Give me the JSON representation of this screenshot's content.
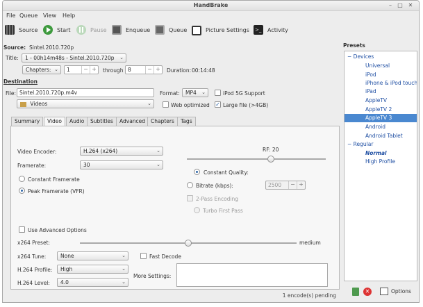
{
  "window": {
    "title": "HandBrake",
    "controls": [
      "–",
      "□",
      "✕"
    ]
  },
  "menu": [
    "File",
    "Queue",
    "View",
    "Help"
  ],
  "toolbar": {
    "source": "Source",
    "start": "Start",
    "pause": "Pause",
    "enqueue": "Enqueue",
    "queue": "Queue",
    "picture_settings": "Picture Settings",
    "activity": "Activity"
  },
  "source": {
    "label": "Source:",
    "value": "Sintel.2010.720p",
    "title_label": "Title:",
    "title_value": "1 - 00h14m48s - Sintel.2010.720p",
    "range_type": "Chapters:",
    "range_start": "1",
    "through_label": "through",
    "range_end": "8",
    "duration_label": "Duration:",
    "duration_value": "00:14:48"
  },
  "destination": {
    "label": "Destination",
    "file_label": "File:",
    "file_value": "Sintel.2010.720p.m4v",
    "format_label": "Format:",
    "format_value": "MP4",
    "ipod_label": "iPod 5G Support",
    "ipod_checked": false,
    "folder": "Videos",
    "web_label": "Web optimized",
    "web_checked": false,
    "large_label": "Large file (>4GB)",
    "large_checked": true
  },
  "tabs": [
    "Summary",
    "Video",
    "Audio",
    "Subtitles",
    "Advanced",
    "Chapters",
    "Tags"
  ],
  "active_tab": "Video",
  "video": {
    "encoder_label": "Video Encoder:",
    "encoder_value": "H.264 (x264)",
    "framerate_label": "Framerate:",
    "framerate_value": "30",
    "cfr_label": "Constant Framerate",
    "pfr_label": "Peak Framerate (VFR)",
    "rf_label": "RF: 20",
    "rf_value": 20,
    "cq_label": "Constant Quality:",
    "bitrate_label": "Bitrate (kbps):",
    "bitrate_value": "2500",
    "twopass_label": "2-Pass Encoding",
    "turbo_label": "Turbo First Pass",
    "advanced_label": "Use Advanced Options",
    "preset_label": "x264 Preset:",
    "preset_value": "medium",
    "tune_label": "x264 Tune:",
    "tune_value": "None",
    "fast_decode_label": "Fast Decode",
    "profile_label": "H.264 Profile:",
    "profile_value": "High",
    "level_label": "H.264 Level:",
    "level_value": "4.0",
    "more_label": "More Settings:"
  },
  "presets": {
    "title": "Presets",
    "groups": [
      {
        "name": "Devices",
        "items": [
          "Universal",
          "iPod",
          "iPhone & iPod touch",
          "iPad",
          "AppleTV",
          "AppleTV 2",
          "AppleTV 3",
          "Android",
          "Android Tablet"
        ]
      },
      {
        "name": "Regular",
        "items": [
          "Normal",
          "High Profile"
        ]
      }
    ],
    "selected": "AppleTV 3",
    "options_label": "Options"
  },
  "status": "1 encode(s) pending",
  "colors": {
    "accent": "#4a88d0",
    "link": "#1f4fa3",
    "window_bg": "#ededed"
  }
}
